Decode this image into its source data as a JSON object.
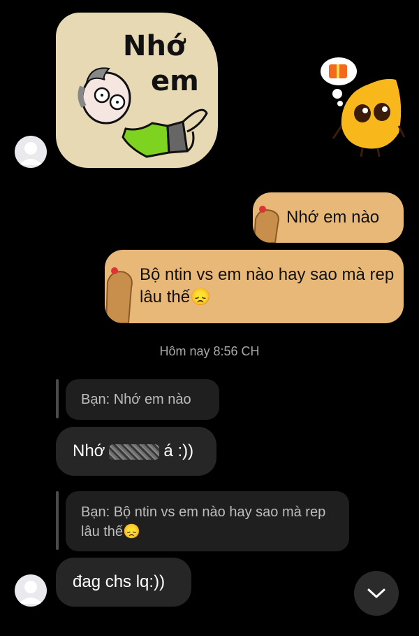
{
  "sticker": {
    "text_line1": "Nhớ",
    "text_line2": "em"
  },
  "messages": {
    "sent1": "Nhớ em nào",
    "sent2": "Bộ ntin vs em nào hay sao mà rep lâu thế😞",
    "timestamp": "Hôm nay 8:56 CH",
    "quote1": "Bạn: Nhớ em nào",
    "reply1_prefix": "Nhớ",
    "reply1_suffix": "á :))",
    "quote2": "Bạn: Bộ ntin vs em nào hay sao mà rep lâu thế😞",
    "reply2": "đag chs lq:))"
  },
  "icons": {
    "scroll": "chevron-down-icon",
    "avatar": "user-avatar-icon",
    "gift": "gift-icon"
  },
  "colors": {
    "tan_bubble": "#e7b878",
    "grey_bubble": "#262626",
    "sticker_bg": "#e7d9b3"
  }
}
